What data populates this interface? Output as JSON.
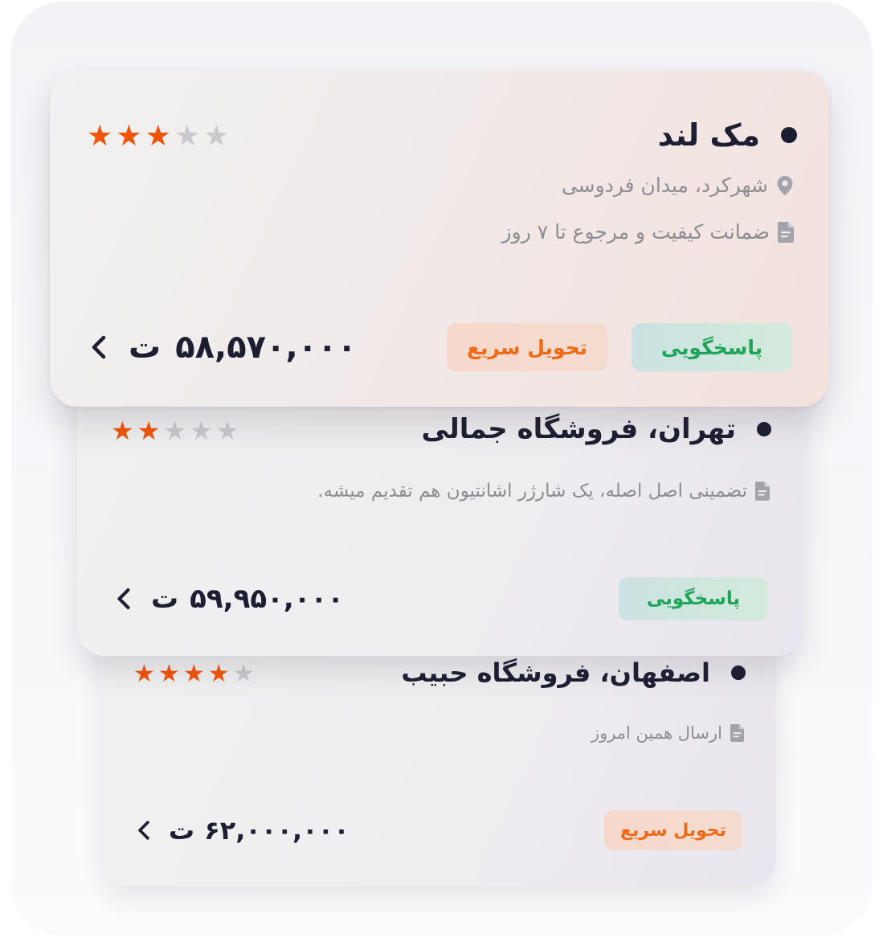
{
  "listings": [
    {
      "title": "مک لند",
      "rating": 3,
      "max_rating": 5,
      "location": "شهرکرد، میدان فردوسی",
      "note": "ضمانت کیفیت و مرجوع تا ۷ روز",
      "badges": [
        "پاسخگویی",
        "تحویل سریع"
      ],
      "price": "۵۸,۵۷۰,۰۰۰",
      "currency": "ت"
    },
    {
      "title": "تهران، فروشگاه جمالی",
      "rating": 2,
      "max_rating": 5,
      "note": "تضمینی اصل اصله، یک شارژر اشانتیون هم تقدیم میشه.",
      "badges": [
        "پاسخگویی"
      ],
      "price": "۵۹,۹۵۰,۰۰۰",
      "currency": "ت"
    },
    {
      "title": "اصفهان، فروشگاه حبیب",
      "rating": 4,
      "max_rating": 5,
      "note": "ارسال همین امروز",
      "badges": [
        "تحویل سریع"
      ],
      "price": "۶۲,۰۰۰,۰۰۰",
      "currency": "ت"
    }
  ],
  "colors": {
    "star_on": "#f2550a",
    "star_off": "#c9c9cf",
    "badge_green_text": "#1fa55a",
    "badge_orange_text": "#ef6a16",
    "text_dark": "#1e1e32",
    "text_muted": "#8d8d94"
  },
  "icons": {
    "location": "location-pin-icon",
    "note": "document-icon",
    "arrow": "chevron-left-icon",
    "rating": "star-icon"
  }
}
